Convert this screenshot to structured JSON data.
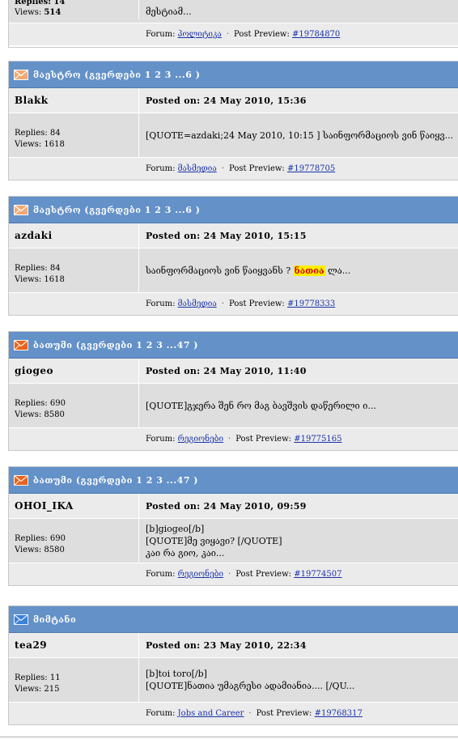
{
  "top_fragment": {
    "replies": "Replies: 14",
    "views_label": "Views: ",
    "views_value": "514",
    "preview": "მესტიამ...",
    "forum_label": "Forum:",
    "forum_name": "პოლიტიკა",
    "preview_label": "Post Preview:",
    "preview_id": "#19784870"
  },
  "posts": [
    {
      "title": "მაესტრო (გვერდები 1 2 3 ...6 )",
      "icon": "envelope-read",
      "author": "Blakk",
      "posted": "Posted on: 24 May 2010, 15:36",
      "replies": "Replies: 84",
      "views": "Views: 1618",
      "line1": "[QUOTE=azdaki;24 May 2010, 10:15 ] საინფორმაციოს ვინ წაიყვ...",
      "line2": "",
      "line3": "",
      "forum_label": "Forum:",
      "forum_name": "მასმედია",
      "preview_label": "Post Preview:",
      "preview_id": "#19778705"
    },
    {
      "title": "მაესტრო (გვერდები 1 2 3 ...6 )",
      "icon": "envelope-read",
      "author": "azdaki",
      "posted": "Posted on: 24 May 2010, 15:15",
      "replies": "Replies: 84",
      "views": "Views: 1618",
      "line1_pre": "საინფორმაციოს ვინ წაიყვანს ? ",
      "line1_hl": "ნათია",
      "line1_post": " ლა...",
      "forum_label": "Forum:",
      "forum_name": "მასმედია",
      "preview_label": "Post Preview:",
      "preview_id": "#19778333"
    },
    {
      "title": "ბათუმი (გვერდები 1 2 3 ...47 )",
      "icon": "envelope-hot",
      "author": "giogeo",
      "posted": "Posted on: 24 May 2010, 11:40",
      "replies": "Replies: 690",
      "views": "Views: 8580",
      "line1": "[QUOTE]გჯერა შენ რო მაგ ბავშვის დაწერილი ი...",
      "line2": "",
      "line3": "",
      "forum_label": "Forum:",
      "forum_name": "რეგიონები",
      "preview_label": "Post Preview:",
      "preview_id": "#19775165"
    },
    {
      "title": "ბათუმი (გვერდები 1 2 3 ...47 )",
      "icon": "envelope-hot",
      "author": "OHOI_IKA",
      "posted": "Posted on: 24 May 2010, 09:59",
      "replies": "Replies: 690",
      "views": "Views: 8580",
      "line1": "[b]giogeo[/b]",
      "line2": "[QUOTE]მე ვიყავი? [/QUOTE]",
      "line3": "კაი რა გიო, კაი...",
      "forum_label": "Forum:",
      "forum_name": "რეგიონები",
      "preview_label": "Post Preview:",
      "preview_id": "#19774507"
    },
    {
      "title": "მიმტანი",
      "icon": "envelope-new",
      "author": "tea29",
      "posted": "Posted on: 23 May 2010, 22:34",
      "replies": "Replies: 11",
      "views": "Views: 215",
      "line1": "[b]toi toro[/b]",
      "line2": "[QUOTE]ნათია უმაგრესი ადამიანია.... [/QU...",
      "line3": "",
      "forum_label": "Forum:",
      "forum_name": "Jobs and Career",
      "preview_label": "Post Preview:",
      "preview_id": "#19768317"
    }
  ],
  "colors": {
    "header_bg": "#6391c8",
    "row_light": "#ebebeb",
    "row_dark": "#dedede",
    "link": "#1a32a8",
    "highlight_bg": "#ffee00",
    "highlight_fg": "#d00000"
  }
}
